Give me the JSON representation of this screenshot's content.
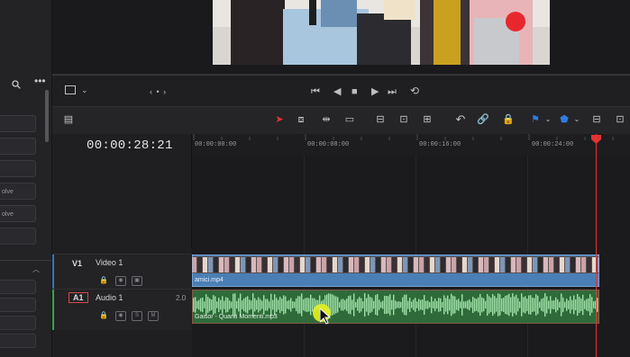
{
  "timeline": {
    "timecode": "00:00:28:21",
    "ruler": [
      "00:00:00:00",
      "00:00:08:00",
      "00:00:16:00",
      "00:00:24:00"
    ]
  },
  "left_panel": {
    "rows": [
      "",
      "",
      "",
      "olve",
      "olve",
      ""
    ]
  },
  "tracks": {
    "video": {
      "id": "V1",
      "name": "Video 1",
      "clip": "amici.mp4"
    },
    "audio": {
      "id": "A1",
      "name": "Audio 1",
      "level": "2.0",
      "clip": "Gaisor - Quanti Momenti.mp3",
      "s": "S",
      "m": "M"
    }
  },
  "colors": {
    "video_clip": "#4a7fb5",
    "audio_clip": "#2f6b3a",
    "audio_wave": "#9ee0a8",
    "playhead": "#e23434",
    "cursor_highlight": "#e6f21e"
  },
  "icons": [
    "search-icon",
    "more-icon",
    "screen-icon",
    "chevron-down-icon",
    "prev-clip-icon",
    "skip-start-icon",
    "step-back-icon",
    "stop-icon",
    "play-icon",
    "skip-end-icon",
    "loop-icon",
    "selection-icon",
    "trim-icon",
    "dynamic-trim-icon",
    "blade-icon",
    "insert-icon",
    "overwrite-icon",
    "replace-icon",
    "snap-icon",
    "link-icon",
    "lock-icon",
    "flag-icon",
    "marker-icon",
    "zoom-icon"
  ]
}
